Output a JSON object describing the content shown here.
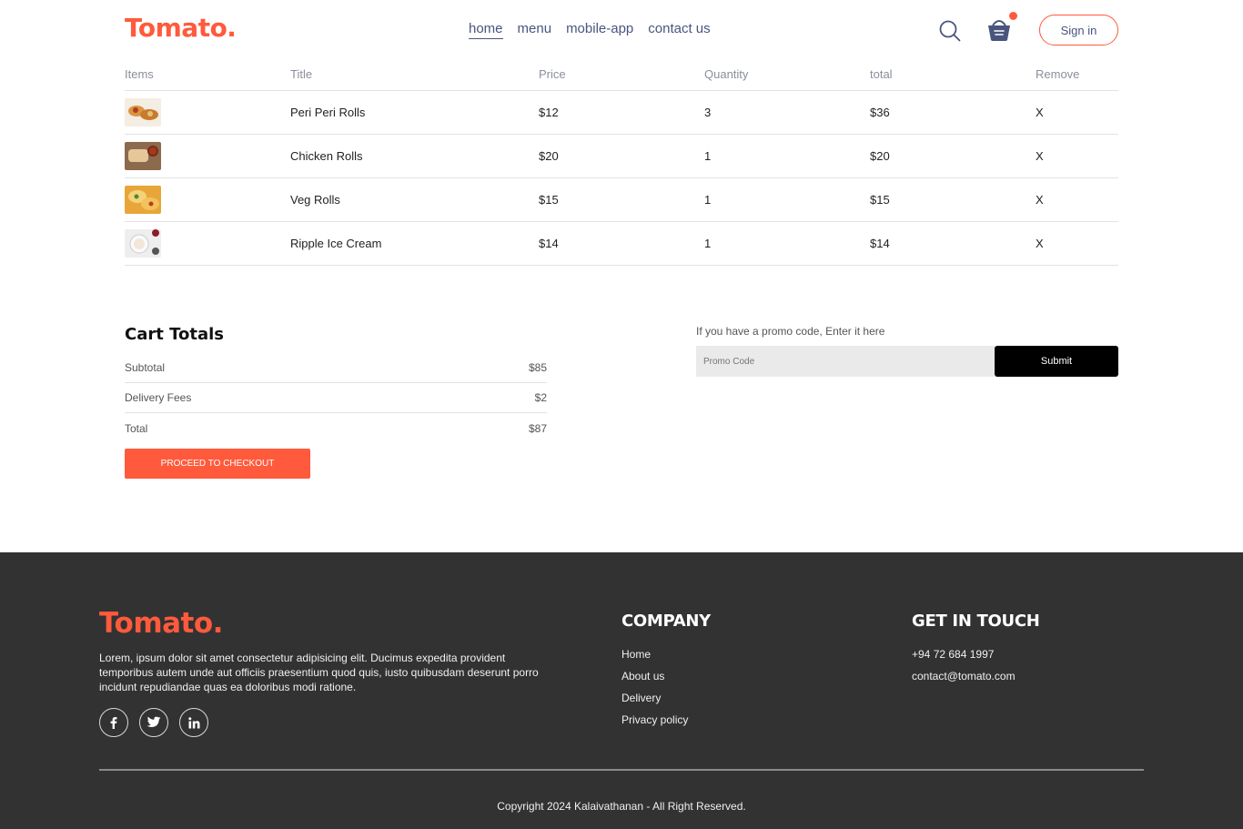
{
  "brand": {
    "name": "Tomato.",
    "color": "#ff5a3c"
  },
  "nav": {
    "items": [
      {
        "label": "home",
        "active": true
      },
      {
        "label": "menu",
        "active": false
      },
      {
        "label": "mobile-app",
        "active": false
      },
      {
        "label": "contact us",
        "active": false
      }
    ],
    "search_icon": "search-icon",
    "basket_icon": "basket-icon",
    "signin_label": "Sign in"
  },
  "cart": {
    "headers": [
      "Items",
      "Title",
      "Price",
      "Quantity",
      "total",
      "Remove"
    ],
    "items": [
      {
        "image": "peri-peri-rolls-thumbnail",
        "title": "Peri Peri Rolls",
        "price": "$12",
        "quantity": "3",
        "total": "$36",
        "remove": "X"
      },
      {
        "image": "chicken-rolls-thumbnail",
        "title": "Chicken Rolls",
        "price": "$20",
        "quantity": "1",
        "total": "$20",
        "remove": "X"
      },
      {
        "image": "veg-rolls-thumbnail",
        "title": "Veg Rolls",
        "price": "$15",
        "quantity": "1",
        "total": "$15",
        "remove": "X"
      },
      {
        "image": "ripple-ice-cream-thumbnail",
        "title": "Ripple Ice Cream",
        "price": "$14",
        "quantity": "1",
        "total": "$14",
        "remove": "X"
      }
    ]
  },
  "totals": {
    "title": "Cart Totals",
    "subtotal_label": "Subtotal",
    "subtotal_value": "$85",
    "delivery_label": "Delivery Fees",
    "delivery_value": "$2",
    "total_label": "Total",
    "total_value": "$87",
    "checkout_label": "PROCEED TO CHECKOUT"
  },
  "promo": {
    "label": "If you have a promo code, Enter it here",
    "placeholder": "Promo Code",
    "submit_label": "Submit"
  },
  "footer": {
    "logo": "Tomato.",
    "description": "Lorem, ipsum dolor sit amet consectetur adipisicing elit. Ducimus expedita provident temporibus autem unde aut officiis praesentium quod quis, iusto quibusdam deserunt porro incidunt repudiandae quas ea doloribus modi ratione.",
    "socials": [
      "facebook-icon",
      "twitter-icon",
      "linkedin-icon"
    ],
    "company_title": "COMPANY",
    "company_links": [
      "Home",
      "About us",
      "Delivery",
      "Privacy policy"
    ],
    "contact_title": "GET IN TOUCH",
    "phone": "+94 72 684 1997",
    "email": "contact@tomato.com",
    "copyright": "Copyright 2024 Kalaivathanan - All Right Reserved.",
    "background": "#323232"
  }
}
